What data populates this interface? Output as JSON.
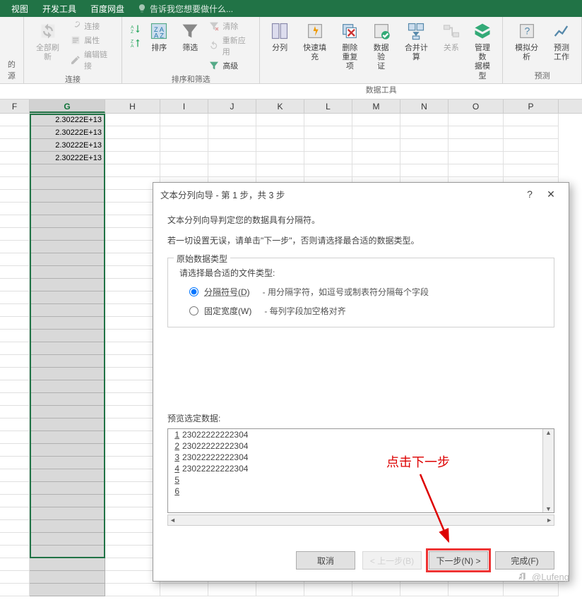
{
  "tabs": {
    "view": "视图",
    "dev": "开发工具",
    "baidu": "百度网盘",
    "tell": "告诉我您想要做什么..."
  },
  "ribbon": {
    "conn": {
      "refresh": "全部刷新",
      "connections": "连接",
      "properties": "属性",
      "editLinks": "编辑链接",
      "source": "的源",
      "group": "连接"
    },
    "sort": {
      "az": "A",
      "za": "Z",
      "sortBtn": "排序",
      "filter": "筛选",
      "clear": "清除",
      "reapply": "重新应用",
      "advanced": "高级",
      "group": "排序和筛选"
    },
    "dataTools": {
      "textToCols": "分列",
      "flashFill": "快速填充",
      "removeDup": "删除\n重复项",
      "validation": "数据验\n证",
      "consolidate": "合并计算",
      "relations": "关系",
      "model": "管理数\n据模型",
      "group": "数据工具"
    },
    "forecast": {
      "whatIf": "模拟分析",
      "sheet": "预测\n工作",
      "group": "预测"
    }
  },
  "columns": [
    "F",
    "G",
    "H",
    "I",
    "J",
    "K",
    "L",
    "M",
    "N",
    "O",
    "P"
  ],
  "gridValues": [
    "2.30222E+13",
    "2.30222E+13",
    "2.30222E+13",
    "2.30222E+13"
  ],
  "dialog": {
    "title": "文本分列向导 - 第 1 步，共 3 步",
    "help": "?",
    "hint1": "文本分列向导判定您的数据具有分隔符。",
    "hint2": "若一切设置无误，请单击\"下一步\"，否则请选择最合适的数据类型。",
    "groupTitle": "原始数据类型",
    "chooseLabel": "请选择最合适的文件类型:",
    "opt1": "分隔符号(D)",
    "opt1desc": "- 用分隔字符，如逗号或制表符分隔每个字段",
    "opt2": "固定宽度(W)",
    "opt2desc": "- 每列字段加空格对齐",
    "previewLabel": "预览选定数据:",
    "previewLines": [
      "23022222222304",
      "23022222222304",
      "23022222222304",
      "23022222222304",
      ""
    ],
    "btnCancel": "取消",
    "btnBack": "< 上一步(B)",
    "btnNext": "下一步(N) >",
    "btnFinish": "完成(F)"
  },
  "annot": {
    "text": "点击下一步"
  },
  "watermark": "@Lufeng"
}
